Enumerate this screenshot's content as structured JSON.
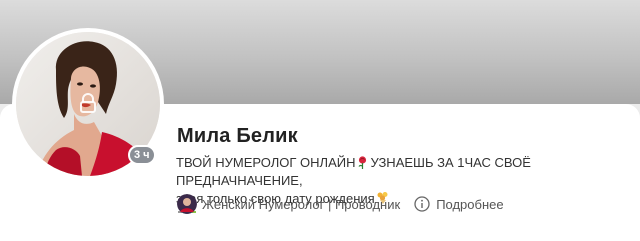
{
  "profile": {
    "name": "Мила Белик",
    "time_badge": "3 ч",
    "bio_line1_part1": "ТВОЙ НУМЕРОЛОГ ОНЛАЙН",
    "bio_line1_part2": "УЗНАЕШЬ ЗА 1ЧАС СВОЁ ПРЕДНАЧНАЧЕНИЕ,",
    "bio_line2": "зная только свою дату рождения",
    "category": "Женский Нумеролог | Проводник",
    "more_label": "Подробнее"
  },
  "icons": {
    "lock": "lock-icon",
    "rose": "rose-emoji-icon",
    "bouquet": "bouquet-emoji-icon",
    "info": "info-icon"
  },
  "colors": {
    "cover_top": "#dcdcdc",
    "cover_bottom": "#a9a9a9",
    "badge_bg": "#8a8f96",
    "dress_red": "#c8102e"
  }
}
